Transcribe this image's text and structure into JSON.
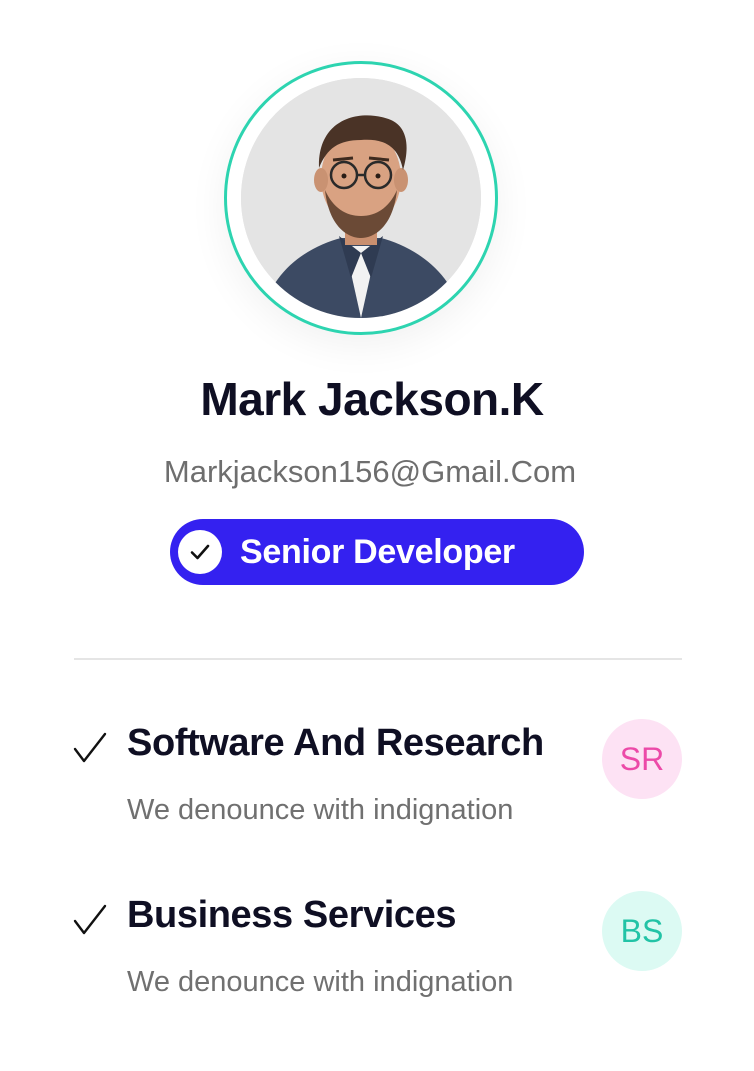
{
  "profile": {
    "name": "Mark Jackson.K",
    "email": "Markjackson156@Gmail.Com",
    "role": "Senior Developer",
    "ring_color": "#2dd4b0",
    "badge_color": "#3421f0"
  },
  "departments": [
    {
      "title": "Software And Research",
      "description": "We denounce with indignation",
      "initials": "SR",
      "badge_bg": "#fde2f4",
      "badge_fg": "#ec4aa8",
      "icon": "check-icon"
    },
    {
      "title": "Business Services",
      "description": "We denounce with indignation",
      "initials": "BS",
      "badge_bg": "#dcfaf3",
      "badge_fg": "#22c3a6",
      "icon": "check-icon"
    }
  ]
}
